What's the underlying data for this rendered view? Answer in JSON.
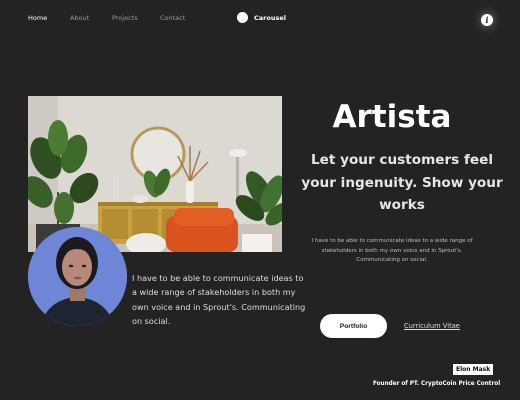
{
  "nav": {
    "items": [
      {
        "label": "Home",
        "active": true
      },
      {
        "label": "About",
        "active": false
      },
      {
        "label": "Projects",
        "active": false
      },
      {
        "label": "Contact",
        "active": false
      }
    ],
    "brand": "Carousel",
    "brand_icon": "circle-logo-icon",
    "info_icon": "info-icon"
  },
  "hero": {
    "title": "Artista",
    "subtitle": "Let your customers feel your ingenuity. Show your works",
    "description": "I have to be able to communicate ideas to a wide range of stakeholders in both my own voice and in Sprout's. Communicating on social.",
    "primary_button": "Portfolio",
    "secondary_link": "Curriculum Vitae"
  },
  "quote": "I have to be able to communicate ideas to a wide range of stakeholders in both my own voice and in Sprout's. Communicating on social.",
  "author": {
    "name": "Elon Mask",
    "role": "Founder of PT. CryptoCoin Price Control"
  },
  "colors": {
    "background": "#232323",
    "text": "#ffffff",
    "muted": "#9a9a9a",
    "portrait_bg": "#6f86d6",
    "sofa": "#d9531e"
  }
}
